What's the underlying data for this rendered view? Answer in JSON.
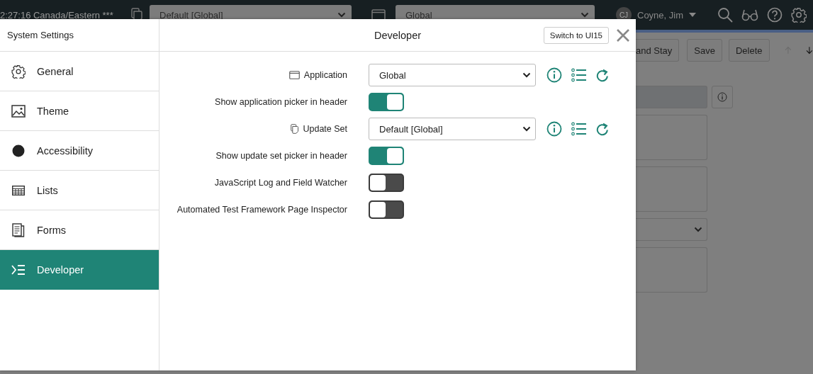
{
  "header": {
    "clock": "2:27:16 Canada/Eastern ***",
    "update_set_picker": "Default [Global]",
    "application_picker": "Global",
    "user": {
      "initials": "CJ",
      "name": "Coyne, Jim"
    }
  },
  "form_toolbar": {
    "buttons": [
      "and Stay",
      "Save",
      "Delete"
    ]
  },
  "form_fields": [
    {
      "kind": "readonly"
    },
    {
      "kind": "textarea"
    },
    {
      "kind": "textarea"
    },
    {
      "kind": "select"
    },
    {
      "kind": "textarea"
    }
  ],
  "dialog": {
    "title": "System Settings",
    "panel_title": "Developer",
    "switch_button": "Switch to UI15",
    "menu": [
      {
        "label": "General",
        "selected": false
      },
      {
        "label": "Theme",
        "selected": false
      },
      {
        "label": "Accessibility",
        "selected": false
      },
      {
        "label": "Lists",
        "selected": false
      },
      {
        "label": "Forms",
        "selected": false
      },
      {
        "label": "Developer",
        "selected": true
      }
    ],
    "settings": [
      {
        "kind": "select",
        "label": "Application",
        "value": "Global"
      },
      {
        "kind": "toggle",
        "label": "Show application picker in header",
        "on": true
      },
      {
        "kind": "select",
        "label": "Update Set",
        "value": "Default [Global]"
      },
      {
        "kind": "toggle",
        "label": "Show update set picker in header",
        "on": true
      },
      {
        "kind": "toggle",
        "label": "JavaScript Log and Field Watcher",
        "on": false
      },
      {
        "kind": "toggle",
        "label": "Automated Test Framework Page Inspector",
        "on": false
      }
    ]
  }
}
